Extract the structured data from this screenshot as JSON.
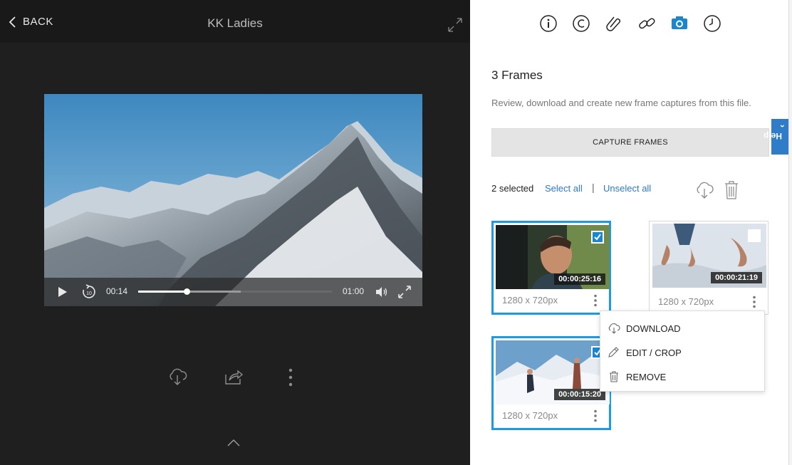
{
  "header": {
    "back_label": "BACK",
    "title": "KK Ladies",
    "expand_icon": "expand-icon"
  },
  "player": {
    "current_time": "00:14",
    "duration": "01:00",
    "progress": 0.25,
    "buffered": 0.53,
    "icons": [
      "play-icon",
      "replay-10-icon",
      "volume-icon",
      "fullscreen-icon"
    ]
  },
  "bottom_tools": {
    "icons": [
      "cloud-download-icon",
      "share-icon",
      "more-icon",
      "chevron-up-icon"
    ]
  },
  "tabs": {
    "icons": [
      "info-icon",
      "copyright-icon",
      "attachment-icon",
      "link-icon",
      "camera-icon",
      "history-icon"
    ],
    "active": "camera-icon",
    "accent": "#1a86d0"
  },
  "frames": {
    "heading": "3 Frames",
    "description": "Review, download and create new frame captures from this file.",
    "capture_label": "CAPTURE FRAMES",
    "help_label": "Help",
    "selected_text": "2 selected",
    "select_all": "Select all",
    "separator": "|",
    "unselect_all": "Unselect all",
    "items": [
      {
        "timecode": "00:00:25:16",
        "dims": "1280 x 720px",
        "selected": true
      },
      {
        "timecode": "00:00:21:19",
        "dims": "1280 x 720px",
        "selected": false
      },
      {
        "timecode": "00:00:15:20",
        "dims": "1280 x 720px",
        "selected": true
      }
    ]
  },
  "context_menu": {
    "items": [
      {
        "label": "DOWNLOAD",
        "icon": "cloud-download-icon"
      },
      {
        "label": "EDIT / CROP",
        "icon": "pencil-icon"
      },
      {
        "label": "REMOVE",
        "icon": "trash-icon"
      }
    ]
  },
  "colors": {
    "selection_border": "#1a9ae8",
    "link": "#2b7bc6",
    "help_tab": "#2f7dc9",
    "dark_bg": "#1f1f1f"
  }
}
